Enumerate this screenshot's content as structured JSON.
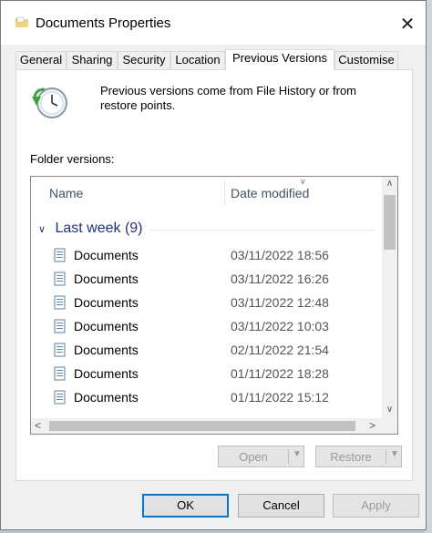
{
  "window": {
    "title": "Documents Properties",
    "close_glyph": "✕",
    "folder_icon": "folder-icon"
  },
  "tabs": [
    {
      "label": "General",
      "active": false
    },
    {
      "label": "Sharing",
      "active": false
    },
    {
      "label": "Security",
      "active": false
    },
    {
      "label": "Location",
      "active": false
    },
    {
      "label": "Previous Versions",
      "active": true
    },
    {
      "label": "Customise",
      "active": false
    }
  ],
  "panel": {
    "description": "Previous versions come from File History or from restore points.",
    "folder_versions_label": "Folder versions:",
    "columns": {
      "name": "Name",
      "date": "Date modified"
    },
    "group": {
      "label": "Last week (9)",
      "chevron": "∨"
    },
    "rows": [
      {
        "name": "Documents",
        "date": "03/11/2022 18:56"
      },
      {
        "name": "Documents",
        "date": "03/11/2022 16:26"
      },
      {
        "name": "Documents",
        "date": "03/11/2022 12:48"
      },
      {
        "name": "Documents",
        "date": "03/11/2022 10:03"
      },
      {
        "name": "Documents",
        "date": "02/11/2022 21:54"
      },
      {
        "name": "Documents",
        "date": "01/11/2022 18:28"
      },
      {
        "name": "Documents",
        "date": "01/11/2022 15:12"
      }
    ],
    "open_label": "Open",
    "restore_label": "Restore"
  },
  "footer": {
    "ok": "OK",
    "cancel": "Cancel",
    "apply": "Apply"
  },
  "colors": {
    "accent": "#0078d7",
    "group_text": "#1e3287",
    "header_text": "#3c5372"
  }
}
